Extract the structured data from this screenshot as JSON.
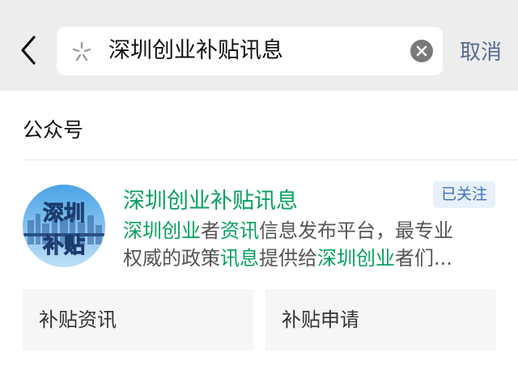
{
  "header": {
    "search_query": "深圳创业补贴讯息",
    "cancel_label": "取消",
    "back_icon": "chevron-left-icon",
    "search_icon": "search-icon",
    "clear_icon": "clear-icon"
  },
  "section": {
    "title": "公众号"
  },
  "account": {
    "name": "深圳创业补贴讯息",
    "status_badge": "已关注",
    "avatar_text_top": "深圳",
    "avatar_text_bottom": "补贴",
    "description_line1": [
      {
        "text": "深圳创业",
        "hl": true
      },
      {
        "text": "者",
        "hl": false
      },
      {
        "text": "资讯",
        "hl": true
      },
      {
        "text": "信息发布平台，最专业",
        "hl": false
      }
    ],
    "description_line2": [
      {
        "text": "权威的政策",
        "hl": false
      },
      {
        "text": "讯息",
        "hl": true
      },
      {
        "text": "提供给",
        "hl": false
      },
      {
        "text": "深圳创业",
        "hl": true
      },
      {
        "text": "者们...",
        "hl": false
      }
    ],
    "highlight_color": "#07a060"
  },
  "menu": {
    "button1": "补贴资讯",
    "button2": "补贴申请"
  }
}
